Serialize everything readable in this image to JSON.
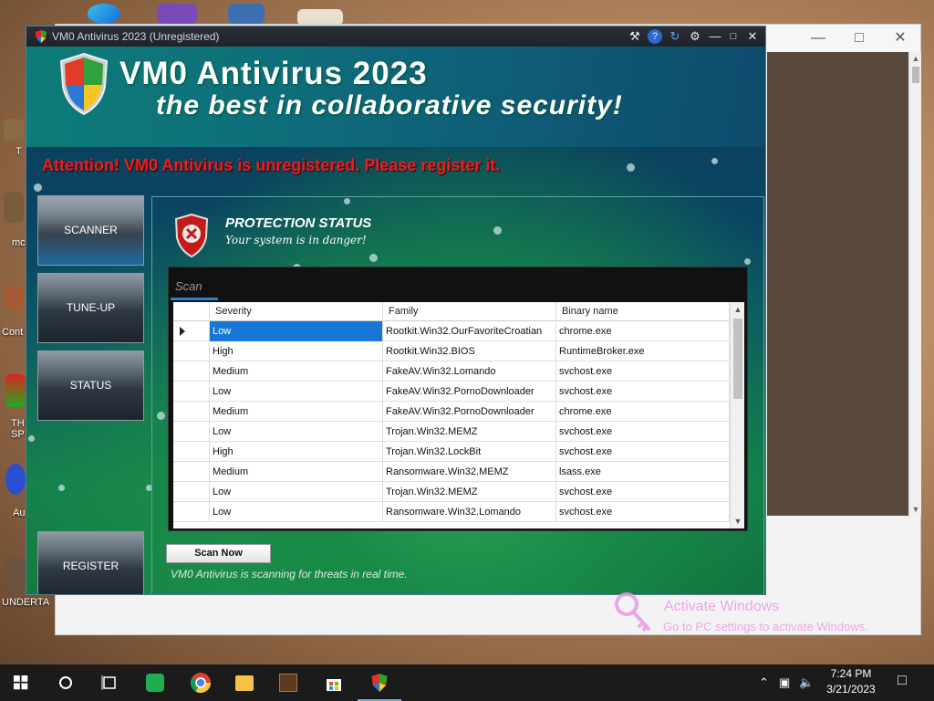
{
  "desktop": {
    "labels": [
      "T",
      "mc",
      "Cont",
      "TH SP",
      "Au",
      "UNDERTA"
    ]
  },
  "app": {
    "window_title": "VM0 Antivirus 2023 (Unregistered)",
    "banner_title": "VM0 Antivirus 2023",
    "banner_subtitle": "the best in collaborative security!",
    "attention": "Attention! VM0 Antivirus is unregistered. Please register it.",
    "sidebar": [
      {
        "label": "SCANNER",
        "active": true
      },
      {
        "label": "TUNE-UP",
        "active": false
      },
      {
        "label": "STATUS",
        "active": false
      },
      {
        "label": "REGISTER",
        "active": false
      }
    ],
    "protection": {
      "title": "PROTECTION STATUS",
      "subtitle": "Your system is in danger!"
    },
    "scan": {
      "label": "Scan",
      "columns": [
        "Severity",
        "Family",
        "Binary name"
      ],
      "rows": [
        [
          "Low",
          "Rootkit.Win32.OurFavoriteCroatian",
          "chrome.exe"
        ],
        [
          "High",
          "Rootkit.Win32.BIOS",
          "RuntimeBroker.exe"
        ],
        [
          "Medium",
          "FakeAV.Win32.Lomando",
          "svchost.exe"
        ],
        [
          "Low",
          "FakeAV.Win32.PornoDownloader",
          "svchost.exe"
        ],
        [
          "Medium",
          "FakeAV.Win32.PornoDownloader",
          "chrome.exe"
        ],
        [
          "Low",
          "Trojan.Win32.MEMZ",
          "svchost.exe"
        ],
        [
          "High",
          "Trojan.Win32.LockBit",
          "svchost.exe"
        ],
        [
          "Medium",
          "Ransomware.Win32.MEMZ",
          "lsass.exe"
        ],
        [
          "Low",
          "Trojan.Win32.MEMZ",
          "svchost.exe"
        ],
        [
          "Low",
          "Ransomware.Win32.Lomando",
          "svchost.exe"
        ]
      ],
      "scan_button": "Scan Now",
      "realtime_text": "VM0 Antivirus is scanning for threats in real time."
    }
  },
  "watermark": {
    "line1": "Activate Windows",
    "line2": "Go to PC settings to activate Windows."
  },
  "taskbar": {
    "time": "7:24 PM",
    "date": "3/21/2023"
  },
  "colors": {
    "attention": "#ee1c1c",
    "selection": "#1677d6",
    "banner": "#0e6e7a"
  }
}
